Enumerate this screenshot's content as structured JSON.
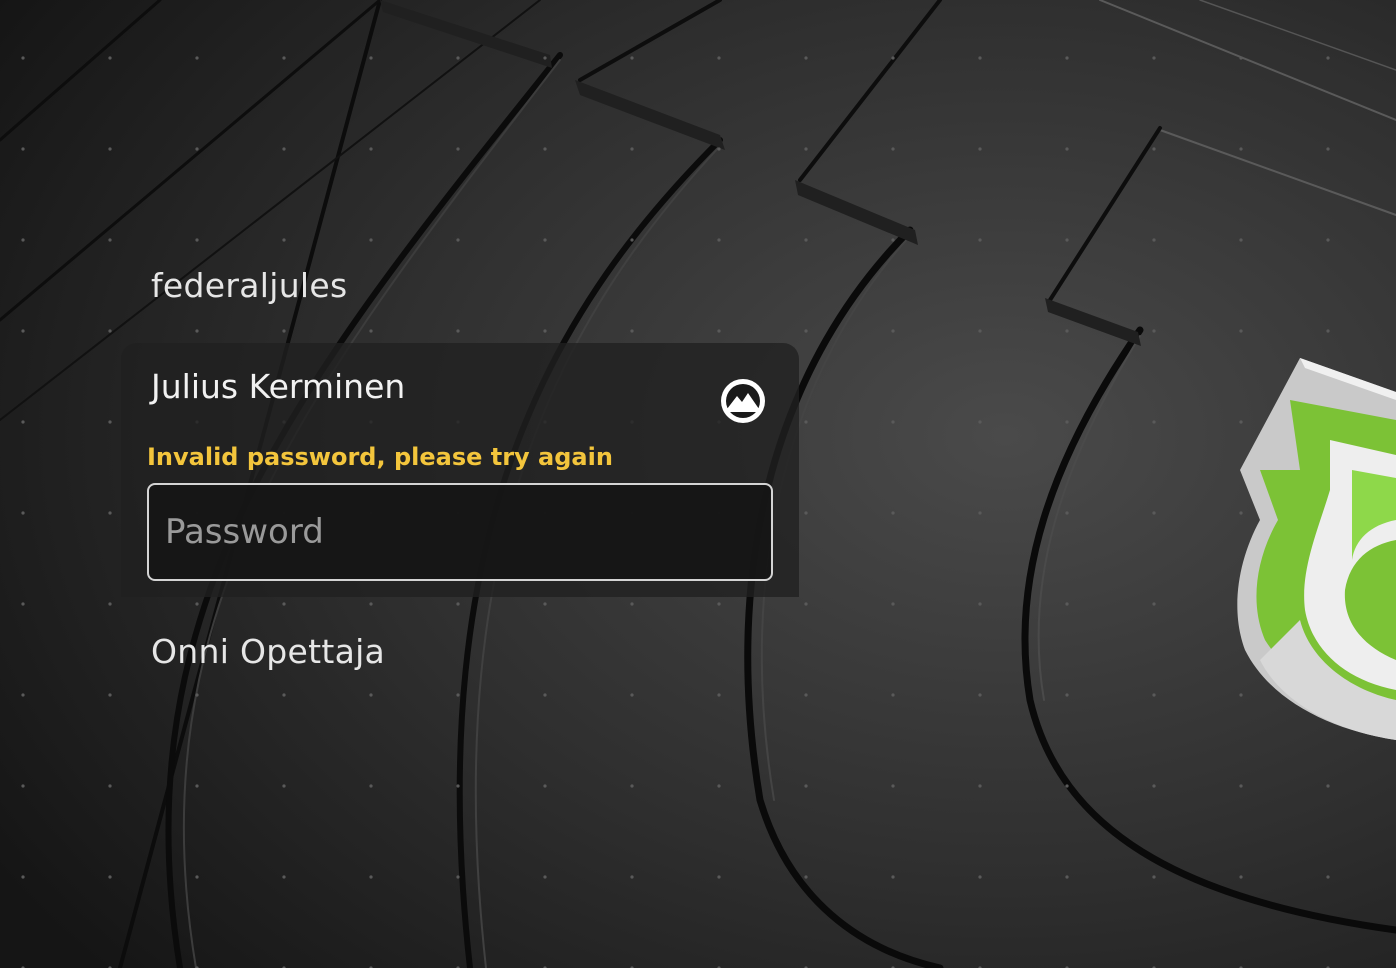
{
  "users": {
    "first": "federaljules",
    "selected": {
      "name": "Julius Kerminen",
      "error": "Invalid password, please try again",
      "password_placeholder": "Password",
      "password_value": ""
    },
    "last": "Onni Opettaja"
  },
  "icons": {
    "session": "session-mountain-icon",
    "logo": "linux-mint-logo"
  },
  "colors": {
    "error": "#f3c53c",
    "logo_green": "#87cf3e",
    "card_bg": "#202020",
    "text": "#e6e6e6"
  }
}
